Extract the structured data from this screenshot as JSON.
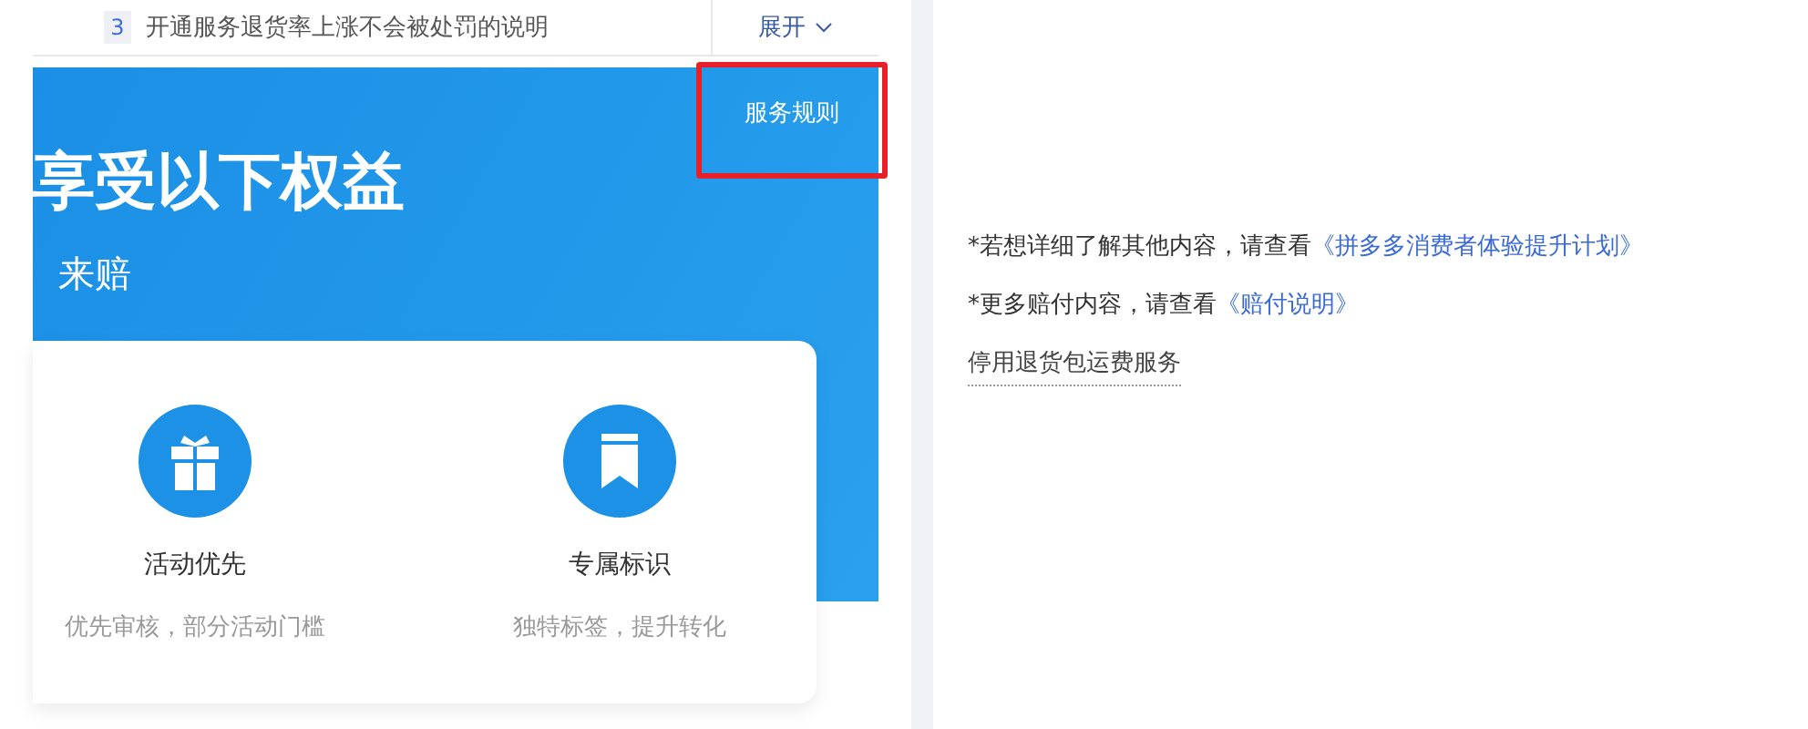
{
  "notice": {
    "index": "3",
    "text": "开通服务退货率上涨不会被处罚的说明",
    "expand_label": "展开"
  },
  "banner": {
    "rules_link": "服务规则",
    "title": "享受以下权益",
    "subtitle": "来赔"
  },
  "benefits": [
    {
      "kind": "gift",
      "title": "活动优先",
      "description": "优先审核，部分活动门槛"
    },
    {
      "kind": "bookmark",
      "title": "专属标识",
      "description": "独特标签，提升转化"
    }
  ],
  "notes": [
    {
      "text": "*若想详细了解其他内容，请查看",
      "link": "《拼多多消费者体验提升计划》"
    },
    {
      "text": "*更多赔付内容，请查看",
      "link": "《赔付说明》"
    }
  ],
  "disable_link": "停用退货包运费服务"
}
